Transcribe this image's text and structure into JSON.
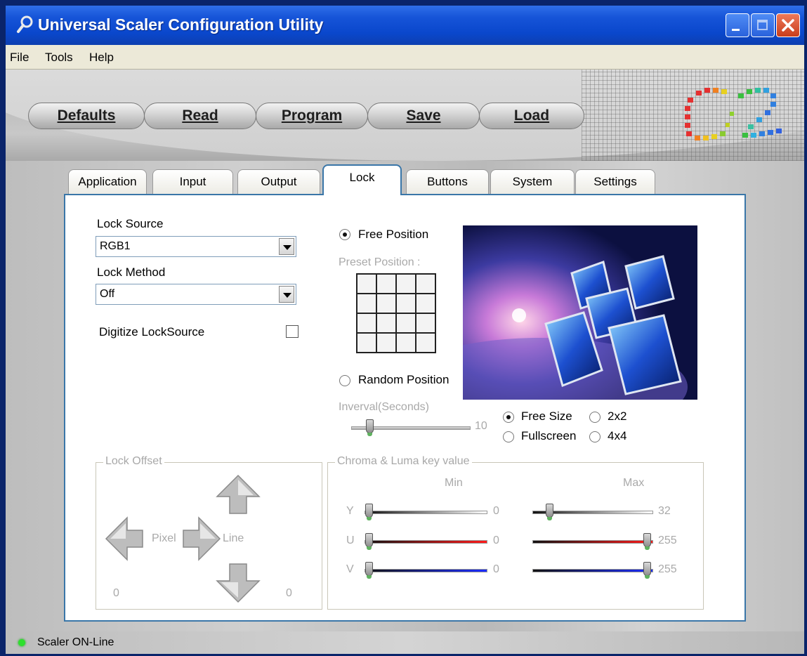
{
  "window": {
    "title": "Universal Scaler Configuration Utility"
  },
  "menu": [
    "File",
    "Tools",
    "Help"
  ],
  "toolbar": [
    "Defaults",
    "Read",
    "Program",
    "Save",
    "Load"
  ],
  "tabs": [
    "Application",
    "Input",
    "Output",
    "Lock",
    "Buttons",
    "System",
    "Settings"
  ],
  "active_tab": "Lock",
  "lock": {
    "source_label": "Lock Source",
    "source_value": "RGB1",
    "method_label": "Lock Method",
    "method_value": "Off",
    "digitize_label": "Digitize LockSource",
    "digitize_checked": false,
    "free_position_label": "Free Position",
    "preset_position_label": "Preset Position :",
    "random_position_label": "Random Position",
    "interval_label": "Inverval(Seconds)",
    "interval_value": "10",
    "size_options": [
      "Free Size",
      "2x2",
      "Fullscreen",
      "4x4"
    ],
    "size_selected": "Free Size"
  },
  "lock_offset": {
    "title": "Lock Offset",
    "pixel_label": "Pixel",
    "line_label": "Line",
    "pixel_value": "0",
    "line_value": "0"
  },
  "chroma": {
    "title": "Chroma & Luma key value",
    "min_label": "Min",
    "max_label": "Max",
    "rows": [
      {
        "channel": "Y",
        "min": "0",
        "max": "32"
      },
      {
        "channel": "U",
        "min": "0",
        "max": "255"
      },
      {
        "channel": "V",
        "min": "0",
        "max": "255"
      }
    ]
  },
  "status": {
    "text": "Scaler ON-Line",
    "led_color": "#2ee02e"
  },
  "icons": [
    "app-icon",
    "minimize-icon",
    "maximize-icon",
    "close-icon",
    "up-arrow-icon",
    "down-arrow-icon",
    "left-arrow-icon",
    "right-arrow-icon"
  ]
}
